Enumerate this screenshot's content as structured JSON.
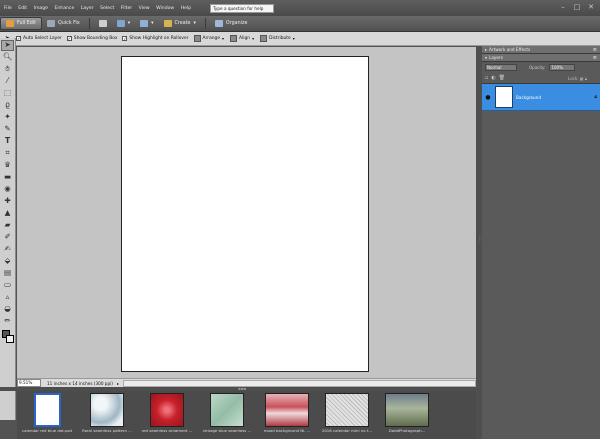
{
  "menu": {
    "items": [
      "File",
      "Edit",
      "Image",
      "Enhance",
      "Layer",
      "Select",
      "Filter",
      "View",
      "Window",
      "Help"
    ],
    "help_placeholder": "Type a question for help"
  },
  "modebar": {
    "full_edit": "Full Edit",
    "quick_fix": "Quick Fix",
    "create": "Create",
    "organize": "Organize"
  },
  "options": {
    "auto_select_layer": "Auto Select Layer",
    "show_bounding_box": "Show Bounding Box",
    "show_highlight": "Show Highlight on Rollover",
    "arrange": "Arrange",
    "align": "Align",
    "distribute": "Distribute"
  },
  "status": {
    "zoom": "9.51%",
    "doc_info": "11 inches x 14 inches (300 ppi)"
  },
  "panels": {
    "artwork_effects": "Artwork and Effects",
    "layers": "Layers",
    "blend_mode": "Normal",
    "opacity_label": "Opacity:",
    "opacity_value": "100%",
    "lock_label": "Lock:",
    "layer_name": "Background"
  },
  "project_bin": {
    "items": [
      {
        "caption": "calendar red blue dot.psd",
        "color": "#ffffff",
        "selected": true
      },
      {
        "caption": "floral seamless pattern ...",
        "color": "#c9d8e0"
      },
      {
        "caption": "red seamless ornament ...",
        "color": "#c8202a"
      },
      {
        "caption": "vintage blue seamless ...",
        "color": "#a9cbb8"
      },
      {
        "caption": "mood background NL ...",
        "color": "#c7525a"
      },
      {
        "caption": "2016 calendar mini no t...",
        "color": "#d9d9d9"
      },
      {
        "caption": "DaddPhotograph...",
        "color": "#7d8c6a"
      }
    ]
  }
}
